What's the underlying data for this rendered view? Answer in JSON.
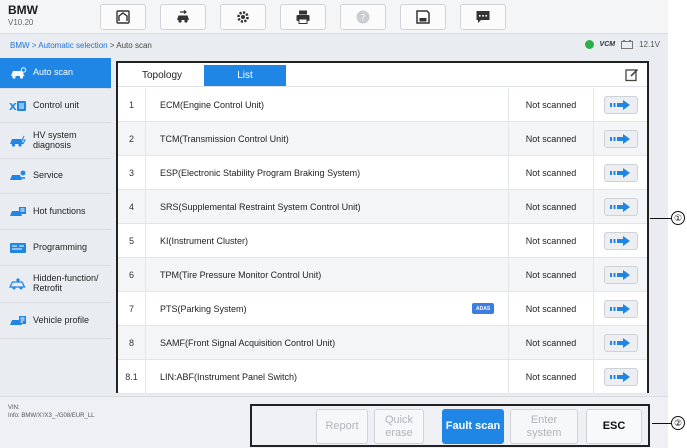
{
  "header": {
    "brand": "BMW",
    "version": "V10.20",
    "toolbar": [
      {
        "name": "home-icon"
      },
      {
        "name": "vehicle-swap-icon"
      },
      {
        "name": "settings-icon"
      },
      {
        "name": "print-icon"
      },
      {
        "name": "help-icon"
      },
      {
        "name": "save-icon"
      },
      {
        "name": "data-logging-icon"
      }
    ]
  },
  "breadcrumb": {
    "link": "BMW > Automatic selection",
    "current": " > Auto scan"
  },
  "status": {
    "vcm": "VCM",
    "voltage": "12.1V"
  },
  "sidebar": {
    "items": [
      {
        "label": "Auto scan",
        "icon": "car-scan-icon",
        "active": true
      },
      {
        "label": "Control unit",
        "icon": "control-unit-icon",
        "active": false
      },
      {
        "label": "HV system\ndiagnosis",
        "icon": "hv-car-icon",
        "active": false
      },
      {
        "label": "Service",
        "icon": "service-icon",
        "active": false
      },
      {
        "label": "Hot functions",
        "icon": "hot-functions-icon",
        "active": false
      },
      {
        "label": "Programming",
        "icon": "programming-icon",
        "active": false
      },
      {
        "label": "Hidden-function/\nRetrofit",
        "icon": "hidden-function-icon",
        "active": false
      },
      {
        "label": "Vehicle profile",
        "icon": "vehicle-profile-icon",
        "active": false
      }
    ]
  },
  "tabs": {
    "topology": "Topology",
    "list": "List"
  },
  "modules": [
    {
      "num": "1",
      "name": "ECM(Engine Control Unit)",
      "status": "Not scanned",
      "badge": ""
    },
    {
      "num": "2",
      "name": "TCM(Transmission Control Unit)",
      "status": "Not scanned",
      "badge": ""
    },
    {
      "num": "3",
      "name": "ESP(Electronic Stability Program Braking System)",
      "status": "Not scanned",
      "badge": ""
    },
    {
      "num": "4",
      "name": "SRS(Supplemental Restraint System Control Unit)",
      "status": "Not scanned",
      "badge": ""
    },
    {
      "num": "5",
      "name": "KI(Instrument Cluster)",
      "status": "Not scanned",
      "badge": ""
    },
    {
      "num": "6",
      "name": "TPM(Tire Pressure Monitor Control Unit)",
      "status": "Not scanned",
      "badge": ""
    },
    {
      "num": "7",
      "name": "PTS(Parking System)",
      "status": "Not scanned",
      "badge": "ADAS"
    },
    {
      "num": "8",
      "name": "SAMF(Front Signal Acquisition Control Unit)",
      "status": "Not scanned",
      "badge": ""
    },
    {
      "num": "8.1",
      "name": "LIN:ABF(Instrument Panel Switch)",
      "status": "Not scanned",
      "badge": ""
    }
  ],
  "footer": {
    "vin_label": "VIN:",
    "info": "Info: BMW/X'/X3_-/G08/EUR_LL",
    "buttons": {
      "report": "Report",
      "quick_erase": "Quick\nerase",
      "fault_scan": "Fault scan",
      "enter_system": "Enter\nsystem",
      "esc": "ESC"
    }
  },
  "callouts": {
    "one": "①",
    "two": "②"
  },
  "colors": {
    "accent": "#1f86e6",
    "badge": "#3b7de0",
    "vcm_ok": "#2cae4a"
  }
}
